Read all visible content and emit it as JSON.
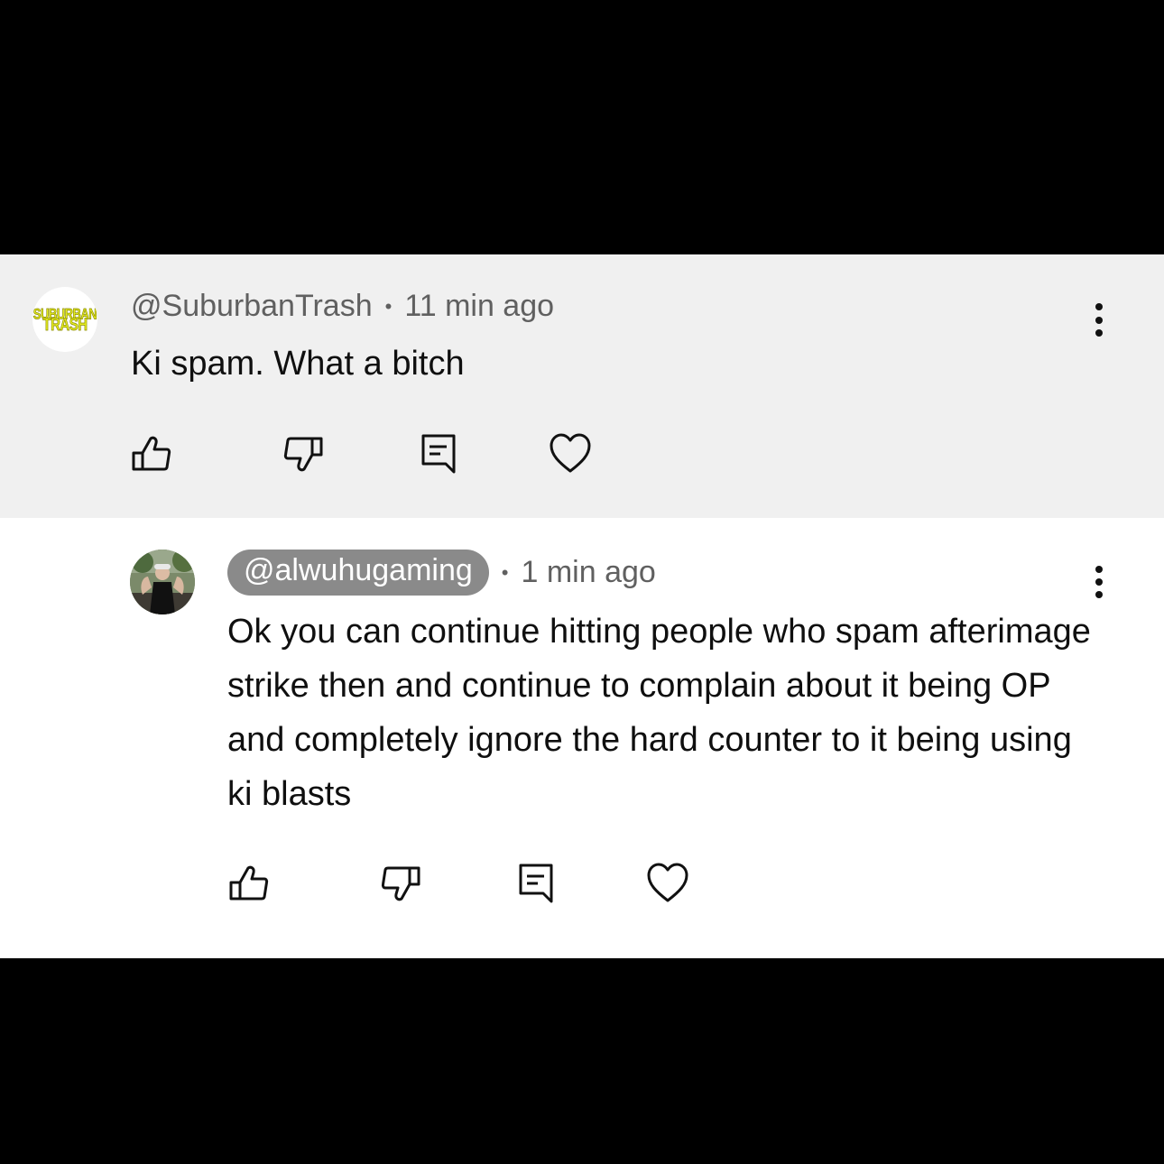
{
  "comments": [
    {
      "handle": "@SuburbanTrash",
      "time": "11 min ago",
      "separator": "•",
      "text": "Ki spam. What a bitch",
      "avatar": {
        "line1": "SUBURBAN",
        "line2": "TRASH",
        "icon": "suburban-trash-logo",
        "color": "#e4ec1f"
      }
    },
    {
      "handle": "@alwuhugaming",
      "time": "1 min ago",
      "separator": "•",
      "text": "Ok you can continue hitting people who spam afterimage strike then and continue to complain about it being OP and completely ignore the hard counter to it being using ki blasts",
      "avatar": {
        "icon": "user-photo-avatar"
      },
      "handle_highlighted": true
    }
  ],
  "actions": [
    "like-icon",
    "dislike-icon",
    "reply-icon",
    "heart-icon"
  ],
  "colors": {
    "parent_bg": "#f0f0f0",
    "reply_bg": "#ffffff",
    "letterbox": "#000000",
    "handle_pill": "#8a8a8a"
  }
}
